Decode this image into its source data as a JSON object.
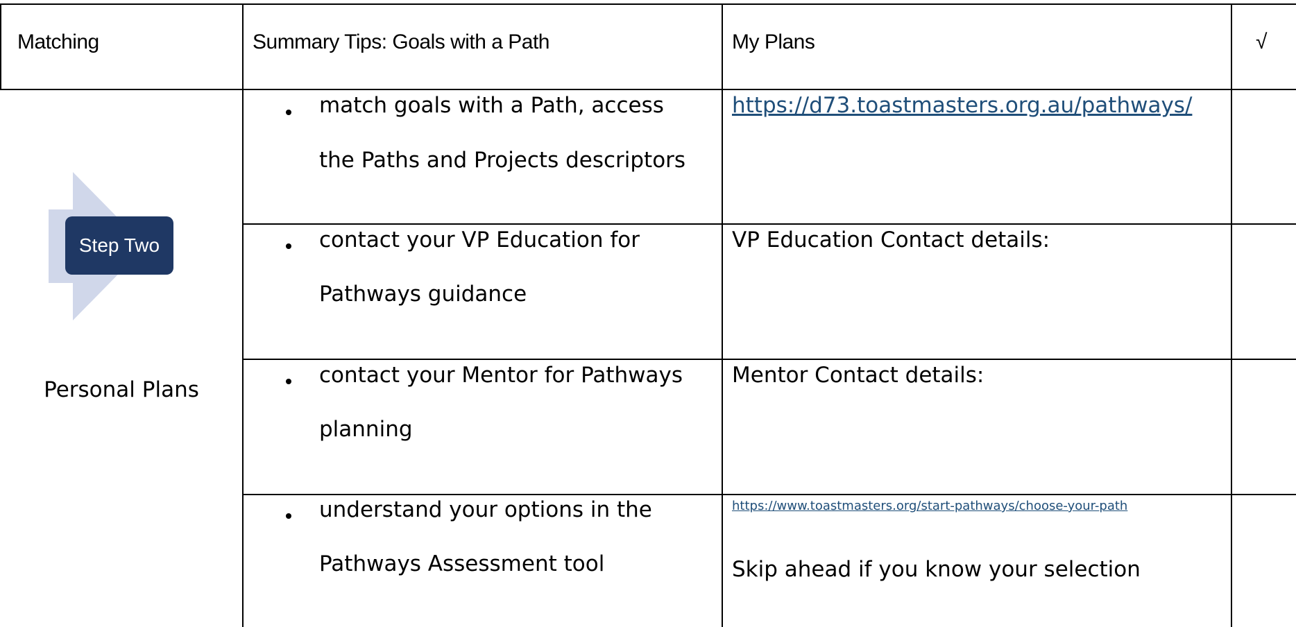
{
  "table": {
    "headers": {
      "matching": "Matching",
      "summary": "Summary Tips: Goals with a Path",
      "plans": "My Plans",
      "check": "√"
    },
    "left": {
      "step_label": "Step Two",
      "section_label": "Personal Plans"
    },
    "rows": [
      {
        "tip_line1": "match goals with a Path, access",
        "tip_line2": "the Paths and Projects descriptors",
        "plan_link": "https://d73.toastmasters.org.au/pathways/"
      },
      {
        "tip_line1": "contact your VP Education for",
        "tip_line2": "Pathways guidance",
        "plan_text": "VP Education Contact details:"
      },
      {
        "tip_line1": "contact your Mentor for Pathways",
        "tip_line2": "planning",
        "plan_text": "Mentor Contact details:"
      },
      {
        "tip_line1": "understand your options in the",
        "tip_line2": "Pathways Assessment tool",
        "plan_link": "https://www.toastmasters.org/start-pathways/choose-your-path",
        "plan_text": "Skip ahead if you know your selection"
      }
    ]
  },
  "colors": {
    "link": "#1f4e79",
    "step_box": "#1f3864",
    "step_arrow": "#d0d7ea"
  },
  "icons": {
    "step_arrow": "chevron-arrow-right-icon",
    "bullet": "bullet-dot-icon"
  }
}
